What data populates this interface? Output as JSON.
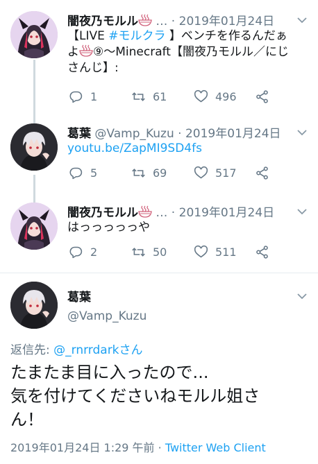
{
  "tweets": [
    {
      "name": "闇夜乃モルル",
      "name_suffix": " …",
      "handle": "",
      "dot": " · ",
      "date": "2019年01月24日",
      "line1": "【LIVE ",
      "line1_tag": "#モルクラ",
      "line1_rest": " 】ベンチを作るんだぁ",
      "line2_a": "よ",
      "line2_b": "⑨〜Minecraft【闇夜乃モルル／にじ",
      "line3": "さんじ】:",
      "replies": "1",
      "retweets": "61",
      "likes": "496"
    },
    {
      "name": "葛葉",
      "handle": "@Vamp_Kuzu",
      "dot": " · ",
      "date": "2019年01月24日",
      "link": "youtu.be/ZapMI9SD4fs",
      "replies": "5",
      "retweets": "69",
      "likes": "517"
    },
    {
      "name": "闇夜乃モルル",
      "name_suffix": " …",
      "dot": " · ",
      "date": "2019年01月24日",
      "text": "はっっっっっや",
      "replies": "2",
      "retweets": "50",
      "likes": "511"
    }
  ],
  "main": {
    "name": "葛葉",
    "handle": "@Vamp_Kuzu",
    "reply_label": "返信先: ",
    "reply_handle": "@_rnrrdarkさん",
    "text_line1": "たまたま目に入ったので...",
    "text_line2": "気を付けてくださいねモルル姐さ",
    "text_line3": "ん！",
    "timestamp": "2019年01月24日 1:29 午前",
    "meta_dot": " · ",
    "client": "Twitter Web Client"
  },
  "icons": [
    "reply-icon",
    "retweet-icon",
    "like-icon",
    "share-icon",
    "chevron-down-icon",
    "ramen-bowl-icon"
  ]
}
